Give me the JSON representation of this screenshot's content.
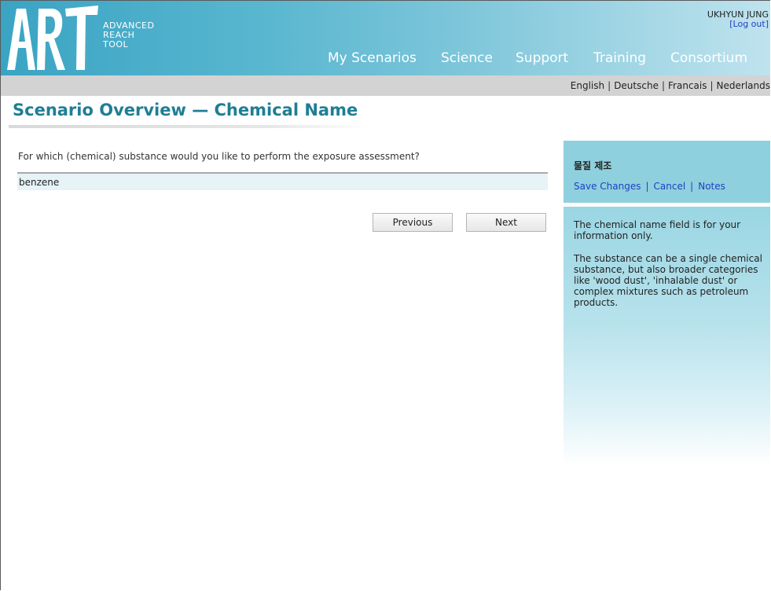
{
  "header": {
    "logo_letters": "ART",
    "logo_lines": [
      "ADVANCED",
      "REACH",
      "TOOL"
    ],
    "user_name": "UKHYUN JUNG",
    "logout_label": "[Log out]",
    "nav": [
      "My Scenarios",
      "Science",
      "Support",
      "Training",
      "Consortium"
    ]
  },
  "languages": [
    "English",
    "Deutsche",
    "Francais",
    "Nederlands"
  ],
  "page_title": "Scenario Overview — Chemical Name",
  "form": {
    "question": "For which (chemical) substance would you like to perform the exposure assessment?",
    "substance_value": "benzene",
    "previous_label": "Previous",
    "next_label": "Next"
  },
  "side_panel": {
    "heading": "물질 제조",
    "links": [
      "Save Changes",
      "Cancel",
      "Notes"
    ],
    "paragraphs": [
      "The chemical name field is for your information only.",
      "The substance can be a single chemical substance, but also broader categories like 'wood dust', 'inhalable dust' or complex mixtures such as petroleum products."
    ]
  },
  "colors": {
    "header_start": "#3aa4c3",
    "header_end": "#bfe3ee",
    "title": "#1f7e94",
    "link": "#1f3fc4",
    "panel": "#8fd0de"
  }
}
